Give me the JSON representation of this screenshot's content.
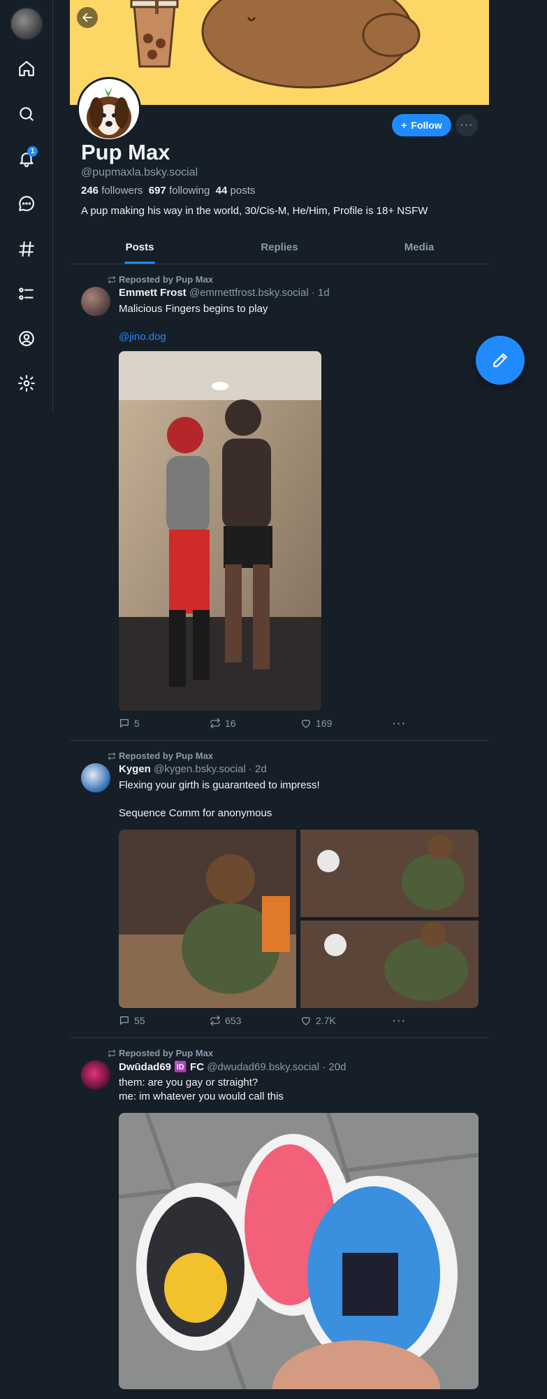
{
  "nav": {
    "notifications_count": "1",
    "items": [
      "home",
      "search",
      "notifications",
      "chat",
      "feeds",
      "lists",
      "profile",
      "settings"
    ]
  },
  "profile": {
    "display_name": "Pup Max",
    "handle": "@pupmaxla.bsky.social",
    "followers_count": "246",
    "followers_label": "followers",
    "following_count": "697",
    "following_label": "following",
    "posts_count": "44",
    "posts_label": "posts",
    "bio": "A pup making his way in the world, 30/Cis-M, He/Him, Profile is 18+ NSFW",
    "follow_label": "Follow",
    "more_label": "···"
  },
  "tabs": [
    {
      "label": "Posts",
      "active": true
    },
    {
      "label": "Replies",
      "active": false
    },
    {
      "label": "Media",
      "active": false
    }
  ],
  "posts": [
    {
      "repost_label": "Reposted by Pup Max",
      "author_name": "Emmett Frost",
      "author_handle": "@emmettfrost.bsky.social",
      "age": "· 1d",
      "text_line1": "Malicious Fingers begins to play",
      "link": "@jino.dog",
      "replies": "5",
      "reposts": "16",
      "likes": "169"
    },
    {
      "repost_label": "Reposted by Pup Max",
      "author_name": "Kygen",
      "author_handle": "@kygen.bsky.social",
      "age": "· 2d",
      "text_line1": "Flexing your girth is guaranteed to impress!",
      "text_line2": "Sequence Comm for anonymous",
      "replies": "55",
      "reposts": "653",
      "likes": "2.7K"
    },
    {
      "repost_label": "Reposted by Pup Max",
      "author_name": "Dwūdad69 🆔 FC",
      "author_handle": "@dwudad69.bsky.social",
      "age": "· 20d",
      "text_line1": "them: are you gay or straight?",
      "text_line2": "me: im whatever you would call this"
    }
  ],
  "colors": {
    "background": "#161e27",
    "accent": "#208bfe",
    "banner": "#fcd766",
    "muted_text": "#8a9bad"
  }
}
